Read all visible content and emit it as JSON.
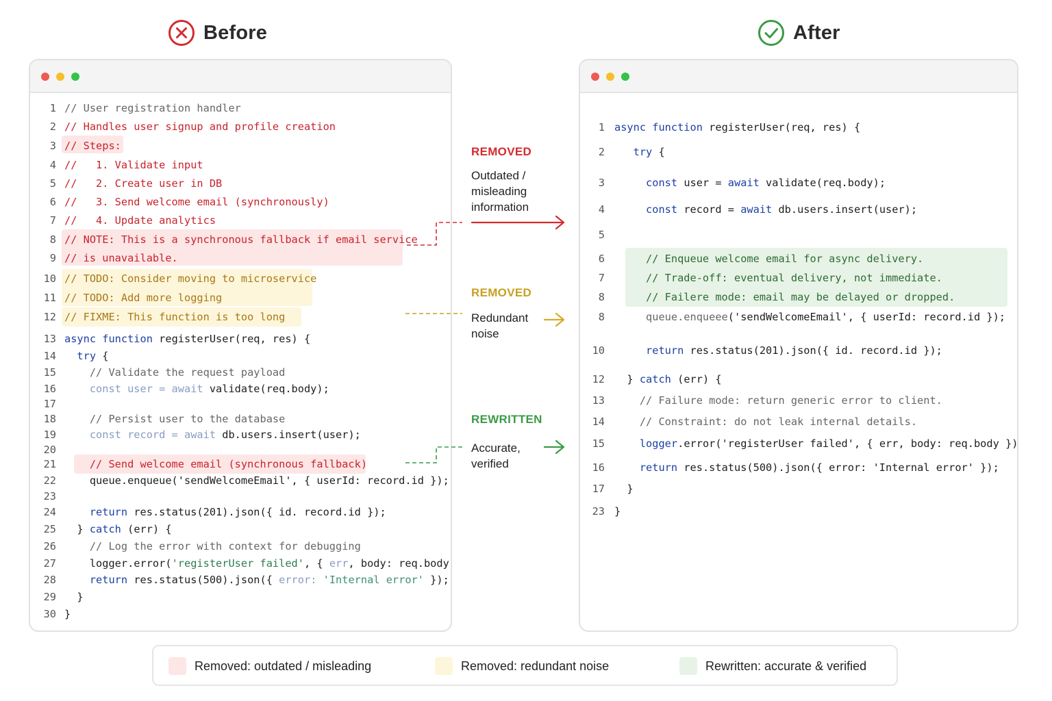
{
  "headings": {
    "before": {
      "label": "Before",
      "icon": "x-circle-icon",
      "color": "#d32b2f"
    },
    "after": {
      "label": "After",
      "icon": "check-circle-icon",
      "color": "#3c9a47"
    }
  },
  "colors": {
    "removed_outdated": "#d32b2f",
    "removed_noise": "#c8a022",
    "rewritten": "#3c9a47",
    "highlight_red": "#fde6e6",
    "highlight_yellow": "#fdf6da",
    "highlight_green": "#e7f3e6"
  },
  "before_code": [
    {
      "n": "1",
      "tokens": [
        [
          "cmt",
          "// User registration handler"
        ]
      ]
    },
    {
      "n": "2",
      "tokens": [
        [
          "cmt-red",
          "// Handles user signup and profile creation"
        ]
      ]
    },
    {
      "n": "3",
      "tokens": [
        [
          "cmt-red",
          "// Steps:"
        ]
      ]
    },
    {
      "n": "4",
      "tokens": [
        [
          "cmt-red",
          "//   1. Validate input"
        ]
      ]
    },
    {
      "n": "5",
      "tokens": [
        [
          "cmt-red",
          "//   2. Create user in DB"
        ]
      ]
    },
    {
      "n": "6",
      "tokens": [
        [
          "cmt-red",
          "//   3. Send welcome email (synchronously)"
        ]
      ]
    },
    {
      "n": "7",
      "tokens": [
        [
          "cmt-red",
          "//   4. Update analytics"
        ]
      ]
    },
    {
      "n": "8",
      "tokens": [
        [
          "cmt-red",
          "// NOTE: This is a synchronous fallback if email service"
        ]
      ]
    },
    {
      "n": "9",
      "tokens": [
        [
          "cmt-red",
          "// is unavailable."
        ]
      ]
    },
    {
      "n": "10",
      "tokens": [
        [
          "cmt-yellow",
          "// TODO: Consider moving to microservice"
        ]
      ]
    },
    {
      "n": "11",
      "tokens": [
        [
          "cmt-yellow",
          "// TODO: Add more logging"
        ]
      ]
    },
    {
      "n": "12",
      "tokens": [
        [
          "cmt-yellow",
          "// FIXME: This function is too long"
        ]
      ]
    },
    {
      "n": "13",
      "tokens": [
        [
          "kw",
          "async function "
        ],
        [
          "plain",
          "registerUser(req, res) {"
        ]
      ]
    },
    {
      "n": "14",
      "tokens": [
        [
          "kw",
          "  try "
        ],
        [
          "plain",
          "{"
        ]
      ]
    },
    {
      "n": "15",
      "tokens": [
        [
          "cmt",
          "    // Validate the request payload"
        ]
      ]
    },
    {
      "n": "16",
      "tokens": [
        [
          "fade",
          "    const user = await "
        ],
        [
          "plain",
          "validate(req.body);"
        ]
      ]
    },
    {
      "n": "17",
      "tokens": []
    },
    {
      "n": "18",
      "tokens": [
        [
          "cmt",
          "    // Persist user to the database"
        ]
      ]
    },
    {
      "n": "19",
      "tokens": [
        [
          "fade",
          "    const record = await "
        ],
        [
          "plain",
          "db.users.insert(user);"
        ]
      ]
    },
    {
      "n": "20",
      "tokens": []
    },
    {
      "n": "21",
      "tokens": [
        [
          "cmt-red",
          "    // Send welcome email (synchronous fallback)"
        ]
      ]
    },
    {
      "n": "22",
      "tokens": [
        [
          "plain",
          "    queue.enqueue('sendWelcomeEmail', { userId: record.id });"
        ]
      ]
    },
    {
      "n": "23",
      "tokens": []
    },
    {
      "n": "24",
      "tokens": [
        [
          "kw",
          "    return "
        ],
        [
          "plain",
          "res.status(201).json({ id. record.id });"
        ]
      ]
    },
    {
      "n": "25",
      "tokens": [
        [
          "plain",
          "  } "
        ],
        [
          "kw",
          "catch "
        ],
        [
          "plain",
          "(err) {"
        ]
      ]
    },
    {
      "n": "26",
      "tokens": [
        [
          "cmt",
          "    // Log the error with context for debugging"
        ]
      ]
    },
    {
      "n": "27",
      "tokens": [
        [
          "plain",
          "    logger.error("
        ],
        [
          "str",
          "'registerUser failed'"
        ],
        [
          "plain",
          ", { "
        ],
        [
          "fade",
          "err"
        ],
        [
          "plain",
          ", body: req.body });"
        ]
      ]
    },
    {
      "n": "28",
      "tokens": [
        [
          "kw",
          "    return "
        ],
        [
          "plain",
          "res.status(500).json({ "
        ],
        [
          "fade",
          "error: "
        ],
        [
          "fstr",
          "'Internal error'"
        ],
        [
          "plain",
          " });"
        ]
      ]
    },
    {
      "n": "29",
      "tokens": [
        [
          "plain",
          "  }"
        ]
      ]
    },
    {
      "n": "30",
      "tokens": [
        [
          "plain",
          "}"
        ]
      ]
    }
  ],
  "after_code": [
    {
      "n": "1",
      "tokens": [
        [
          "kw",
          "async function "
        ],
        [
          "plain",
          "registerUser(req, res) {"
        ]
      ]
    },
    {
      "n": "2",
      "tokens": [
        [
          "kw",
          "   try "
        ],
        [
          "plain",
          "{"
        ]
      ]
    },
    {
      "n": "3",
      "tokens": [
        [
          "kw",
          "     const "
        ],
        [
          "plain",
          "user = "
        ],
        [
          "kw",
          "await "
        ],
        [
          "plain",
          "validate(req.body);"
        ]
      ]
    },
    {
      "n": "4",
      "tokens": [
        [
          "kw",
          "     const "
        ],
        [
          "plain",
          "record = "
        ],
        [
          "kw",
          "await "
        ],
        [
          "plain",
          "db.users.insert(user);"
        ]
      ]
    },
    {
      "n": "5",
      "tokens": []
    },
    {
      "n": "6",
      "tokens": [
        [
          "cmt-green",
          "     // Enqueue welcome email for async delivery."
        ]
      ]
    },
    {
      "n": "7",
      "tokens": [
        [
          "cmt-green",
          "     // Trade-off: eventual delivery, not immediate."
        ]
      ]
    },
    {
      "n": "8",
      "tokens": [
        [
          "cmt-green",
          "     // Failere mode: email may be delayed or dropped."
        ]
      ]
    },
    {
      "n": "8",
      "tokens": [
        [
          "cmt",
          "     queue.enqueee"
        ],
        [
          "plain",
          "('sendWelcomeEmail', { userId: record.id });"
        ]
      ]
    },
    {
      "n": "10",
      "tokens": [
        [
          "kw",
          "     return "
        ],
        [
          "plain",
          "res.status(201).json({ id. record.id });"
        ]
      ]
    },
    {
      "n": "12",
      "tokens": [
        [
          "plain",
          "  } "
        ],
        [
          "kw",
          "catch "
        ],
        [
          "plain",
          "(err) {"
        ]
      ]
    },
    {
      "n": "13",
      "tokens": [
        [
          "cmt",
          "    // Failure mode: return generic error to client."
        ]
      ]
    },
    {
      "n": "14",
      "tokens": [
        [
          "cmt",
          "    // Constraint: do not leak internal details."
        ]
      ]
    },
    {
      "n": "15",
      "tokens": [
        [
          "kw",
          "    logger"
        ],
        [
          "plain",
          ".error('registerUser failed', { err, body: req.body });"
        ]
      ]
    },
    {
      "n": "16",
      "tokens": [
        [
          "kw",
          "    return "
        ],
        [
          "plain",
          "res.status(500).json({ error: 'Internal error' });"
        ]
      ]
    },
    {
      "n": "17",
      "tokens": [
        [
          "plain",
          "  }"
        ]
      ]
    },
    {
      "n": "23",
      "tokens": [
        [
          "plain",
          "}"
        ]
      ]
    }
  ],
  "annotations": [
    {
      "label": "REMOVED",
      "desc": "Outdated / misleading information",
      "color": "#d32b2f"
    },
    {
      "label": "REMOVED",
      "desc": "Redundant noise",
      "color": "#c8a022"
    },
    {
      "label": "REWRITTEN",
      "desc": "Accurate, verified",
      "color": "#3c9a47"
    }
  ],
  "legend": [
    {
      "label": "Removed: outdated / misleading",
      "swatch": "#fde6e6"
    },
    {
      "label": "Removed: redundant noise",
      "swatch": "#fdf6da"
    },
    {
      "label": "Rewritten: accurate & verified",
      "swatch": "#e7f3e6"
    }
  ]
}
